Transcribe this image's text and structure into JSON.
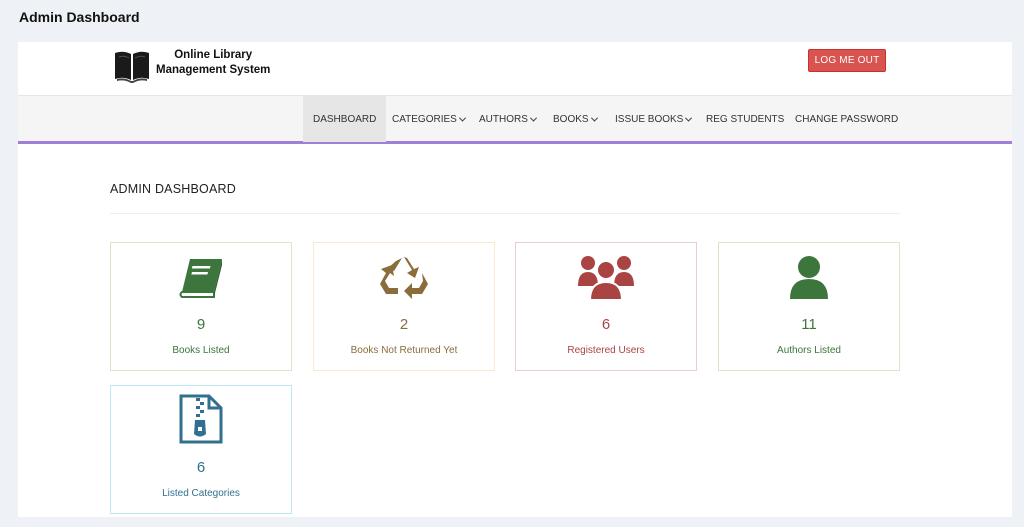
{
  "window": {
    "title": "Admin Dashboard"
  },
  "header": {
    "brand_line1": "Online Library",
    "brand_line2": "Management System",
    "logout_label": "LOG ME OUT",
    "logo_icon": "open-book-icon"
  },
  "nav": {
    "items": [
      {
        "label": "DASHBOARD",
        "dropdown": false
      },
      {
        "label": "CATEGORIES",
        "dropdown": true
      },
      {
        "label": "AUTHORS",
        "dropdown": true
      },
      {
        "label": "BOOKS",
        "dropdown": true
      },
      {
        "label": "ISSUE BOOKS",
        "dropdown": true
      },
      {
        "label": "REG STUDENTS",
        "dropdown": false
      },
      {
        "label": "CHANGE PASSWORD",
        "dropdown": false
      }
    ],
    "active": "DASHBOARD",
    "accent_color": "#9f7fd7"
  },
  "main": {
    "heading": "ADMIN DASHBOARD",
    "cards": [
      {
        "count": "9",
        "label": "Books Listed",
        "icon": "book-icon",
        "color": "#3c763d"
      },
      {
        "count": "2",
        "label": "Books Not Returned Yet",
        "icon": "recycle-icon",
        "color": "#8a6d3b"
      },
      {
        "count": "6",
        "label": "Registered Users",
        "icon": "users-icon",
        "color": "#a94442"
      },
      {
        "count": "11",
        "label": "Authors Listed",
        "icon": "user-icon",
        "color": "#3c763d"
      },
      {
        "count": "6",
        "label": "Listed Categories",
        "icon": "zip-file-icon",
        "color": "#31708f"
      }
    ]
  }
}
